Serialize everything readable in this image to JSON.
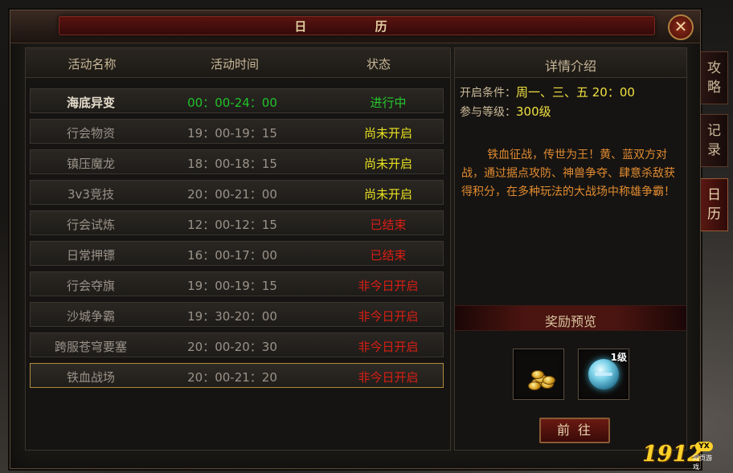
{
  "window": {
    "title": "日 历",
    "close_label": "✕"
  },
  "table": {
    "headers": [
      "活动名称",
      "活动时间",
      "状态"
    ],
    "rows": [
      {
        "name": "海底异变",
        "time": "00：00-24：00",
        "status": "进行中",
        "status_color": "green"
      },
      {
        "name": "行会物资",
        "time": "19：00-19：15",
        "status": "尚未开启",
        "status_color": "yellow"
      },
      {
        "name": "镇压魔龙",
        "time": "18：00-18：15",
        "status": "尚未开启",
        "status_color": "yellow"
      },
      {
        "name": "3v3竞技",
        "time": "20：00-21：00",
        "status": "尚未开启",
        "status_color": "yellow"
      },
      {
        "name": "行会试炼",
        "time": "12：00-12：15",
        "status": "已结束",
        "status_color": "red"
      },
      {
        "name": "日常押镖",
        "time": "16：00-17：00",
        "status": "已结束",
        "status_color": "red"
      },
      {
        "name": "行会夺旗",
        "time": "19：00-19：15",
        "status": "非今日开启",
        "status_color": "red"
      },
      {
        "name": "沙城争霸",
        "time": "19：30-20：00",
        "status": "非今日开启",
        "status_color": "red"
      },
      {
        "name": "跨服苍穹要塞",
        "time": "20：00-20：30",
        "status": "非今日开启",
        "status_color": "red"
      },
      {
        "name": "铁血战场",
        "time": "20：00-21：20",
        "status": "非今日开启",
        "status_color": "red"
      }
    ]
  },
  "detail": {
    "title": "详情介绍",
    "open_label": "开启条件：",
    "open_value": "周一、三、五 20：00",
    "level_label": "参与等级：",
    "level_value": "300级",
    "description": "铁血征战，传世为王！黄、蓝双方对战，通过据点攻防、神兽争夺、肆意杀敌获得积分，在多种玩法的大战场中称雄争霸！"
  },
  "reward": {
    "title": "奖励预览",
    "items": [
      {
        "icon": "gold-coins-icon"
      },
      {
        "icon": "blue-orb-icon",
        "level": "1级"
      }
    ],
    "goto_label": "前往"
  },
  "side_tabs": [
    "攻略",
    "记录",
    "日历"
  ],
  "logo": {
    "number": "1912",
    "badge": "YX",
    "subtitle": "网页游戏"
  },
  "colors": {
    "green": "#26c82a",
    "yellow": "#e8e020",
    "red": "#d81e14",
    "gold": "#ffd22a"
  }
}
